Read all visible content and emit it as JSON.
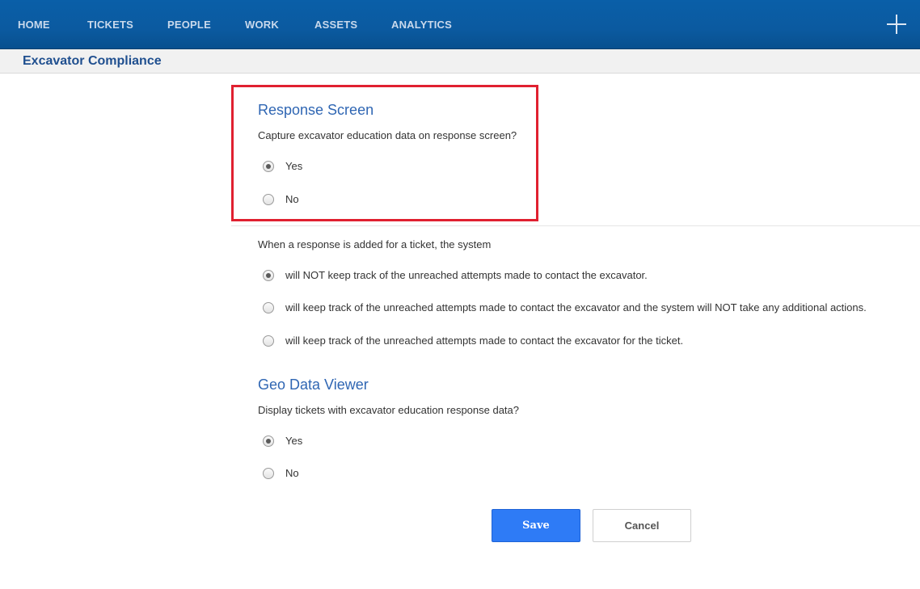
{
  "nav": {
    "items": [
      "HOME",
      "TICKETS",
      "PEOPLE",
      "WORK",
      "ASSETS",
      "ANALYTICS"
    ],
    "add_icon": "plus-icon"
  },
  "page": {
    "title": "Excavator Compliance"
  },
  "response_screen": {
    "heading": "Response Screen",
    "question": "Capture excavator education data on response screen?",
    "options": [
      {
        "label": "Yes",
        "checked": true
      },
      {
        "label": "No",
        "checked": false
      }
    ]
  },
  "unreached_tracking": {
    "question": "When a response is added for a ticket, the system",
    "options": [
      {
        "label": "will NOT keep track of the unreached attempts made to contact the excavator.",
        "checked": true
      },
      {
        "label": "will keep track of the unreached attempts made to contact the excavator and the system will NOT take any additional actions.",
        "checked": false
      },
      {
        "label": "will keep track of the unreached attempts made to contact the excavator for the ticket.",
        "checked": false
      }
    ]
  },
  "geo_data_viewer": {
    "heading": "Geo Data Viewer",
    "question": "Display tickets with excavator education response data?",
    "options": [
      {
        "label": "Yes",
        "checked": true
      },
      {
        "label": "No",
        "checked": false
      }
    ]
  },
  "actions": {
    "save_label": "Save",
    "cancel_label": "Cancel"
  },
  "colors": {
    "nav_bg": "#0b5aa0",
    "heading_blue": "#2f66b3",
    "highlight_red": "#e02030",
    "save_blue": "#2e7bf6"
  }
}
